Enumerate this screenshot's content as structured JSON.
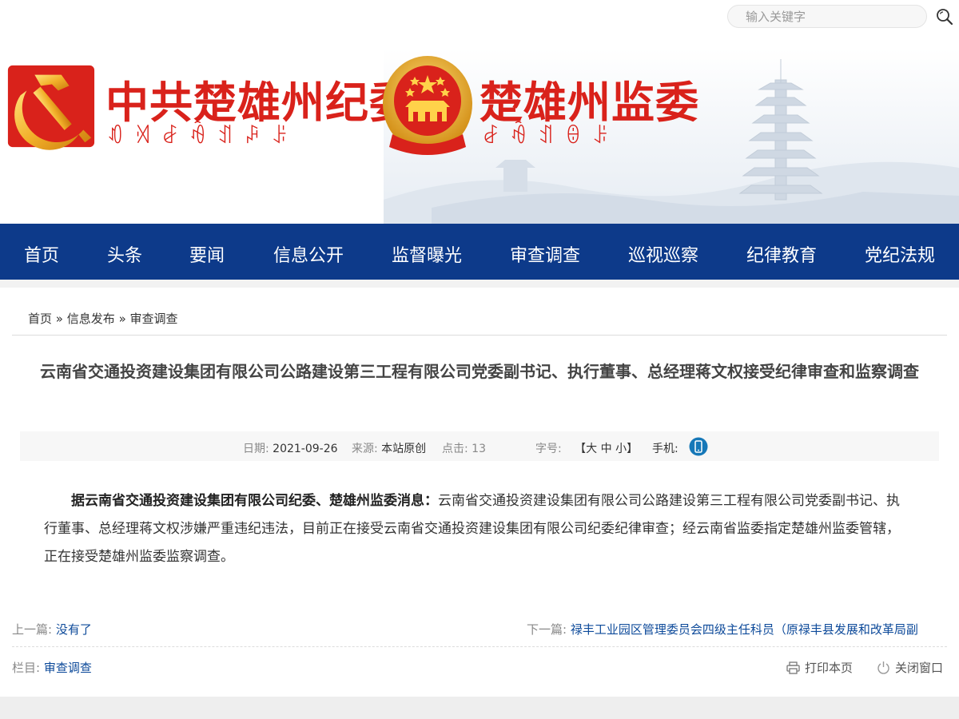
{
  "header": {
    "search_placeholder": "输入关键字",
    "title_cpc": "中共楚雄州纪委",
    "title_supervision": "楚雄州监委",
    "script_cpc": "ꀒꄉꆀꆁꀊꇮꌠ",
    "script_supervision": "ꆀꆁꀊꎔꌠ",
    "brand_red": "#d9221b"
  },
  "nav": {
    "bg_color": "#0d3a8a",
    "items": [
      {
        "label": "首页"
      },
      {
        "label": "头条"
      },
      {
        "label": "要闻"
      },
      {
        "label": "信息公开"
      },
      {
        "label": "监督曝光"
      },
      {
        "label": "审查调查"
      },
      {
        "label": "巡视巡察"
      },
      {
        "label": "纪律教育"
      },
      {
        "label": "党纪法规"
      }
    ]
  },
  "breadcrumb": {
    "home": "首页",
    "sep": "»",
    "level1": "信息发布",
    "level2": "审查调查"
  },
  "article": {
    "title": "云南省交通投资建设集团有限公司公路建设第三工程有限公司党委副书记、执行董事、总经理蒋文权接受纪律审查和监察调查",
    "meta": {
      "date_label": "日期:",
      "date": "2021-09-26",
      "source_label": "来源:",
      "source": "本站原创",
      "clicks_label": "点击:",
      "clicks": "13",
      "fontsize_label": "字号:",
      "fontsize_open": "【",
      "size_large": "大",
      "size_medium": "中",
      "size_small": "小",
      "fontsize_close": "】",
      "mobile_label": "手机:"
    },
    "lead": "据云南省交通投资建设集团有限公司纪委、楚雄州监委消息：",
    "body": "云南省交通投资建设集团有限公司公路建设第三工程有限公司党委副书记、执行董事、总经理蒋文权涉嫌严重违纪违法，目前正在接受云南省交通投资建设集团有限公司纪委纪律审查；经云南省监委指定楚雄州监委管辖，正在接受楚雄州监委监察调查。"
  },
  "pager": {
    "prev_label": "上一篇:",
    "prev_text": "没有了",
    "next_label": "下一篇:",
    "next_text": "禄丰工业园区管理委员会四级主任科员（原禄丰县发展和改革局副"
  },
  "column": {
    "label": "栏目:",
    "value": "审查调查"
  },
  "tools": {
    "print": "打印本页",
    "close": "关闭窗口"
  }
}
